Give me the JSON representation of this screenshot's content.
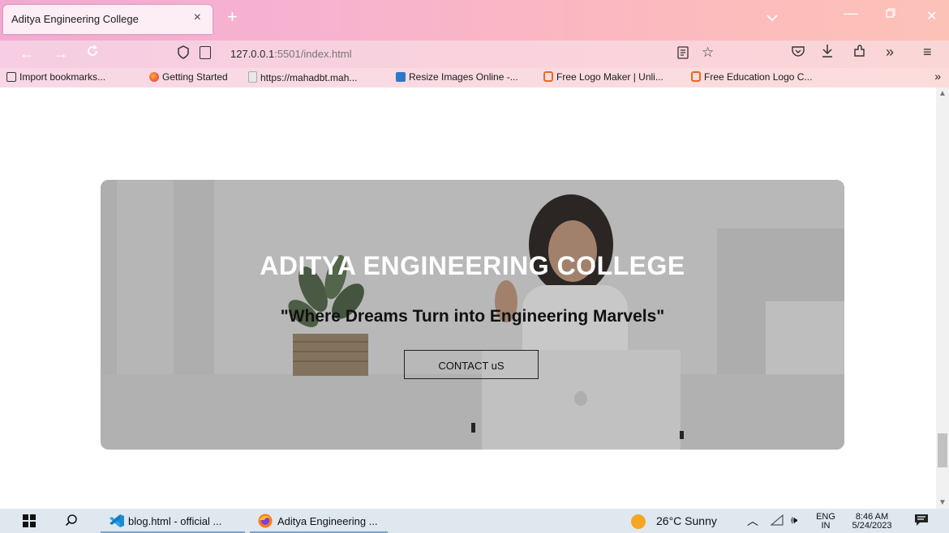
{
  "browser": {
    "tab": {
      "title": "Aditya Engineering College",
      "close_glyph": "×"
    },
    "new_tab_glyph": "+",
    "address": {
      "host": "127.0.0.1",
      "rest": ":5501/index.html"
    },
    "bookmarks": [
      {
        "label": "Import bookmarks...",
        "icon": "import-icon"
      },
      {
        "label": "Getting Started",
        "icon": "firefox-icon"
      },
      {
        "label": "https://mahadbt.mah...",
        "icon": "page-icon"
      },
      {
        "label": "Resize Images Online -...",
        "icon": "resize-icon"
      },
      {
        "label": "Free Logo Maker | Unli...",
        "icon": "logo-maker-icon"
      },
      {
        "label": "Free Education Logo C...",
        "icon": "logo-maker-icon"
      }
    ]
  },
  "page": {
    "hero": {
      "title": "ADITYA ENGINEERING COLLEGE",
      "tagline": "\"Where Dreams Turn into Engineering Marvels\"",
      "button": "CONTACT uS"
    }
  },
  "taskbar": {
    "apps": [
      {
        "label": "blog.html - official ...",
        "icon": "vscode-icon"
      },
      {
        "label": "Aditya Engineering ...",
        "icon": "firefox-icon"
      }
    ],
    "weather": {
      "temp": "26°C",
      "condition": "Sunny"
    },
    "language": {
      "line1": "ENG",
      "line2": "IN"
    },
    "clock": {
      "time": "8:46 AM",
      "date": "5/24/2023"
    }
  },
  "colors": {
    "tab_gradient_start": "#f3a9d2",
    "tab_gradient_end": "#fcc2b7",
    "hero_title": "#ffffff",
    "hero_tagline": "#111111",
    "taskbar": "#dfe8ef"
  }
}
